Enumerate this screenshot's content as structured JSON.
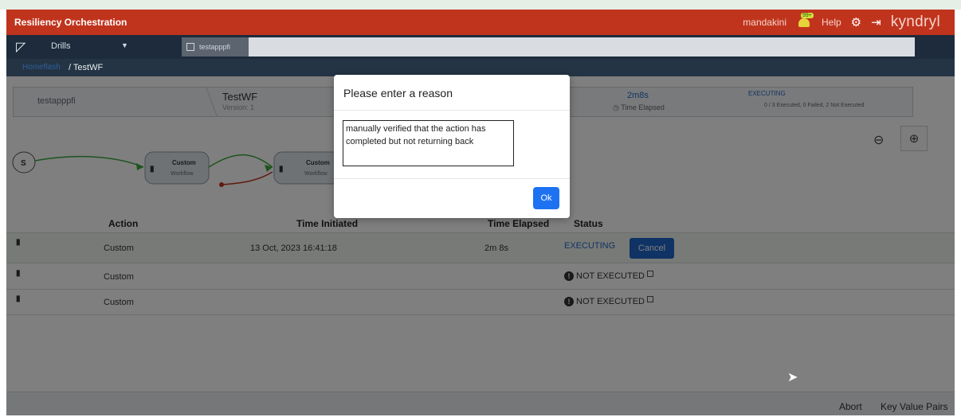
{
  "header": {
    "app_title": "Resiliency Orchestration",
    "user": "mandakini",
    "notification_badge": "99+",
    "help_label": "Help",
    "brand": "kyndryl",
    "colors": {
      "header_bg": "#c0341d",
      "toolbar_bg": "#1d2b3c",
      "accent": "#1f66c9"
    }
  },
  "toolbar": {
    "drill_label": "Drills",
    "workflow_tab": "testapppfi"
  },
  "breadcrumb": {
    "link": "Homeflash",
    "current": "/ TestWF"
  },
  "summary": {
    "name": "testapppfi",
    "workflow": "TestWF",
    "version": "Version: 1",
    "time": "2m8s",
    "time_label": "Time Elapsed",
    "status": "EXECUTING",
    "counts": "0 / 3 Executed, 0 Failed, 2 Not Executed"
  },
  "diagram": {
    "start_label": "S",
    "nodes": [
      {
        "title": "Custom",
        "subtitle": "Workflow"
      },
      {
        "title": "Custom",
        "subtitle": "Workflow"
      }
    ]
  },
  "table": {
    "headers": {
      "action": "Action",
      "time_initiated": "Time Initiated",
      "time_elapsed": "Time Elapsed",
      "status": "Status"
    },
    "rows": [
      {
        "action": "Custom",
        "time_initiated": "13 Oct, 2023 16:41:18",
        "time_elapsed": "2m 8s",
        "status": "EXECUTING"
      },
      {
        "action": "Custom",
        "time_initiated": "",
        "time_elapsed": "",
        "status": "NOT EXECUTED"
      },
      {
        "action": "Custom",
        "time_initiated": "",
        "time_elapsed": "",
        "status": "NOT EXECUTED"
      }
    ],
    "cancel_label": "Cancel"
  },
  "footer": {
    "abort": "Abort",
    "kv": "Key Value Pairs"
  },
  "modal": {
    "title": "Please enter a reason",
    "reason": "manually verified that the action has completed but not returning back",
    "ok_label": "Ok"
  }
}
